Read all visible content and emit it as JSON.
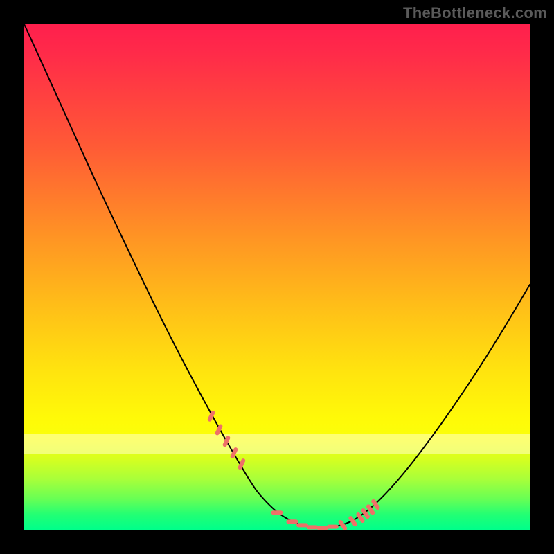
{
  "watermark": "TheBottleneck.com",
  "colors": {
    "page_bg": "#000000",
    "curve": "#000000",
    "marker": "#ee7168",
    "gradient_top": "#ff1f4d",
    "gradient_bottom": "#00ff8a"
  },
  "chart_data": {
    "type": "line",
    "title": "",
    "xlabel": "",
    "ylabel": "",
    "xlim": [
      0,
      100
    ],
    "ylim": [
      0,
      100
    ],
    "grid": false,
    "legend": false,
    "series": [
      {
        "name": "bottleneck-curve",
        "x": [
          0,
          5,
          10,
          15,
          20,
          25,
          30,
          35,
          40,
          45,
          47,
          50,
          53,
          55,
          58,
          60,
          63,
          66,
          70,
          75,
          80,
          85,
          90,
          95,
          100
        ],
        "y": [
          100,
          89,
          78,
          67,
          56.5,
          46,
          36,
          26.5,
          17.5,
          9,
          6.4,
          3.4,
          1.6,
          0.9,
          0.4,
          0.4,
          0.9,
          2.3,
          5.5,
          11,
          17.5,
          24.5,
          32,
          40,
          48.5
        ]
      }
    ],
    "markers_cluster": {
      "name": "highlighted-points",
      "description": "rounded markers along the valley and its sides",
      "x": [
        37,
        38.5,
        40,
        41.5,
        43,
        50,
        53,
        55,
        57,
        59,
        61,
        63,
        65,
        66.5,
        67.5,
        68.5,
        69.5
      ],
      "y": [
        22.5,
        19.8,
        17.5,
        15.2,
        13,
        3.4,
        1.6,
        0.9,
        0.5,
        0.4,
        0.6,
        0.9,
        1.7,
        2.4,
        3.2,
        4,
        5
      ]
    },
    "bands": [
      {
        "name": "pale-band",
        "y_from": 15,
        "y_to": 19,
        "opacity": 0.55
      }
    ]
  }
}
